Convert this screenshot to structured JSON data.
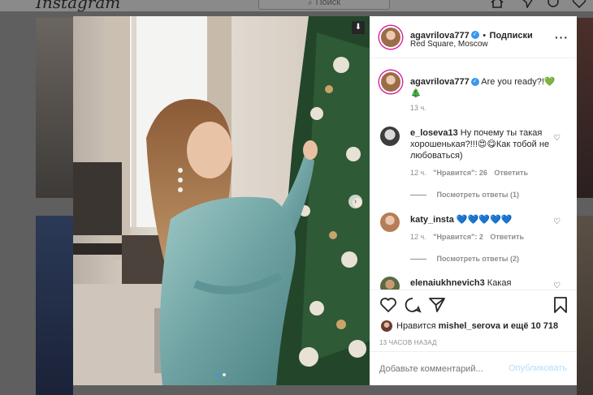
{
  "app": {
    "logo": "Instagram",
    "search_placeholder": "Поиск"
  },
  "post": {
    "author": "agavrilova777",
    "follow_label": "Подписки",
    "location": "Red Square, Moscow",
    "caption": "Are you ready?!💚🎄",
    "caption_time": "13 ч.",
    "time_ago": "13 ЧАСОВ НАЗАД"
  },
  "comments": [
    {
      "user": "e_loseva13",
      "text": "Ну почему ты такая хорошенькая?!!!😍😋Как тобой не любоваться)",
      "time": "12 ч.",
      "likes": "\"Нравится\": 26",
      "reply": "Ответить",
      "view_replies": "Посмотреть ответы (1)"
    },
    {
      "user": "katy_insta",
      "text": "💙💙💙💙💙",
      "time": "12 ч.",
      "likes": "\"Нравится\": 2",
      "reply": "Ответить",
      "view_replies": "Посмотреть ответы (2)"
    },
    {
      "user": "elenaiukhnevich3",
      "text": "Какая"
    }
  ],
  "likes_line": {
    "prefix": "Нравится",
    "user": "mishel_serova",
    "middle": "и ещё",
    "count": "10 718"
  },
  "add_comment": {
    "placeholder": "Добавьте комментарий...",
    "publish": "Опубликовать"
  },
  "icons": [
    "heart-icon",
    "comment-icon",
    "share-icon",
    "bookmark-icon",
    "more-icon",
    "home-icon",
    "direct-icon",
    "explore-icon",
    "activity-icon",
    "tag-icon",
    "next-arrow-icon"
  ],
  "colors": {
    "accent": "#3897f0",
    "publish_disabled": "#b2dffc",
    "text": "#262626",
    "muted": "#8e8e8e"
  }
}
